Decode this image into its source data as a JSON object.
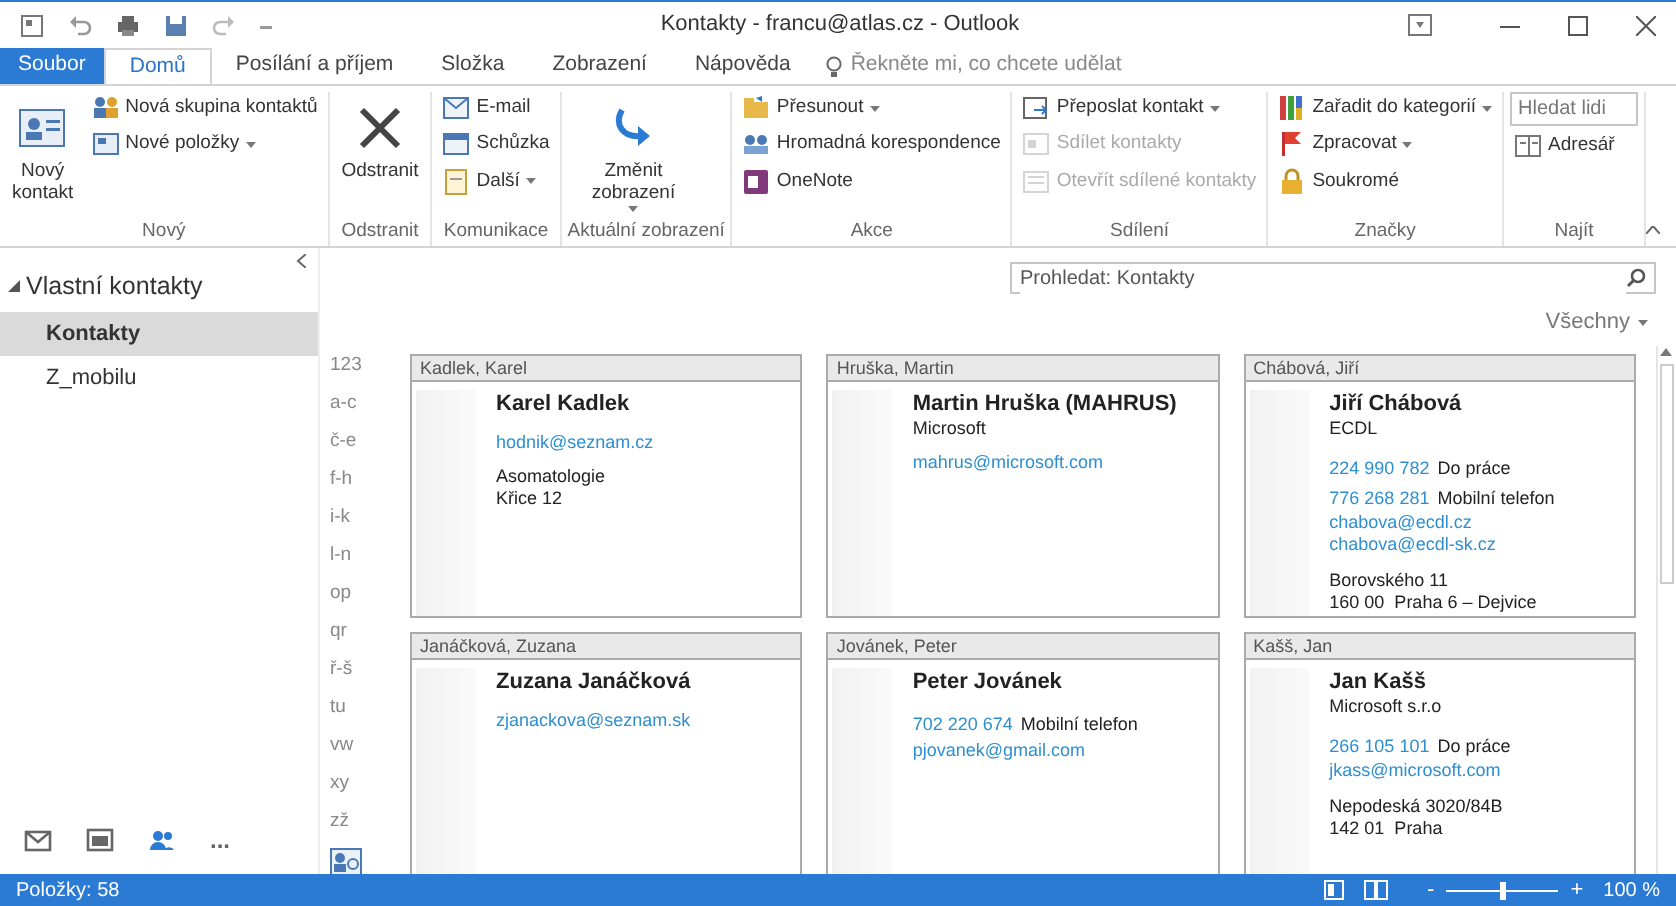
{
  "window": {
    "title": "Kontakty - francu@atlas.cz - Outlook"
  },
  "tabs": [
    {
      "label": "Soubor",
      "kind": "file",
      "selected": false
    },
    {
      "label": "Domů",
      "kind": "tab",
      "selected": true
    },
    {
      "label": "Posílání a příjem",
      "kind": "tab",
      "selected": false
    },
    {
      "label": "Složka",
      "kind": "tab",
      "selected": false
    },
    {
      "label": "Zobrazení",
      "kind": "tab",
      "selected": false
    },
    {
      "label": "Nápověda",
      "kind": "tab",
      "selected": false
    }
  ],
  "tell_me": {
    "placeholder": "Řekněte mi, co chcete udělat"
  },
  "ribbon": {
    "groups": [
      {
        "label": "Nový",
        "items": [
          {
            "kind": "large",
            "label": "Nový kontakt",
            "dropdown": false
          },
          {
            "kind": "stack",
            "items": [
              {
                "kind": "small",
                "label": "Nová skupina kontaktů",
                "dropdown": false,
                "disabled": false
              },
              {
                "kind": "small",
                "label": "Nové položky",
                "dropdown": true,
                "disabled": false
              }
            ]
          }
        ]
      },
      {
        "label": "Odstranit",
        "items": [
          {
            "kind": "large",
            "label": "Odstranit",
            "dropdown": false
          }
        ]
      },
      {
        "label": "Komunikace",
        "items": [
          {
            "kind": "stack",
            "items": [
              {
                "kind": "small",
                "label": "E-mail",
                "dropdown": false,
                "disabled": false
              },
              {
                "kind": "small",
                "label": "Schůzka",
                "dropdown": false,
                "disabled": false
              },
              {
                "kind": "small",
                "label": "Další",
                "dropdown": true,
                "disabled": false
              }
            ]
          }
        ]
      },
      {
        "label": "Aktuální zobrazení",
        "items": [
          {
            "kind": "large",
            "label": "Změnit zobrazení",
            "dropdown": true
          }
        ]
      },
      {
        "label": "Akce",
        "items": [
          {
            "kind": "stack",
            "items": [
              {
                "kind": "small",
                "label": "Přesunout",
                "dropdown": true,
                "disabled": false
              },
              {
                "kind": "small",
                "label": "Hromadná korespondence",
                "dropdown": false,
                "disabled": false
              },
              {
                "kind": "small",
                "label": "OneNote",
                "dropdown": false,
                "disabled": false
              }
            ]
          }
        ]
      },
      {
        "label": "Sdílení",
        "items": [
          {
            "kind": "stack",
            "items": [
              {
                "kind": "small",
                "label": "Přeposlat kontakt",
                "dropdown": true,
                "disabled": false
              },
              {
                "kind": "small",
                "label": "Sdílet kontakty",
                "dropdown": false,
                "disabled": true
              },
              {
                "kind": "small",
                "label": "Otevřít sdílené kontakty",
                "dropdown": false,
                "disabled": true
              }
            ]
          }
        ]
      },
      {
        "label": "Značky",
        "items": [
          {
            "kind": "stack",
            "items": [
              {
                "kind": "small",
                "label": "Zařadit do kategorií",
                "dropdown": true,
                "disabled": false
              },
              {
                "kind": "small",
                "label": "Zpracovat",
                "dropdown": true,
                "disabled": false
              },
              {
                "kind": "small",
                "label": "Soukromé",
                "dropdown": false,
                "disabled": false
              }
            ]
          }
        ]
      },
      {
        "label": "Najít",
        "items": [
          {
            "kind": "stack",
            "items": [
              {
                "kind": "field",
                "placeholder": "Hledat lidi"
              },
              {
                "kind": "small",
                "label": "Adresář",
                "dropdown": false,
                "disabled": false
              }
            ]
          }
        ]
      }
    ]
  },
  "folders": {
    "group": "Vlastní kontakty",
    "items": [
      {
        "label": "Kontakty",
        "selected": true
      },
      {
        "label": "Z_mobilu",
        "selected": false
      }
    ]
  },
  "nav_bar": [
    {
      "kind": "mail",
      "selected": false
    },
    {
      "kind": "calendar",
      "selected": false
    },
    {
      "kind": "people",
      "selected": true
    },
    {
      "kind": "more",
      "label": "...",
      "selected": false
    }
  ],
  "search": {
    "placeholder": "Prohledat: Kontakty"
  },
  "filter": {
    "label": "Všechny"
  },
  "index": [
    "123",
    "a-c",
    "č-e",
    "f-h",
    "i-k",
    "l-n",
    "op",
    "qr",
    "ř-š",
    "tu",
    "vw",
    "xy",
    "zž"
  ],
  "cards": [
    {
      "header": "Kadlek, Karel",
      "name": "Karel Kadlek",
      "contacts": [
        {
          "kind": "email",
          "value": "hodnik@seznam.cz"
        }
      ],
      "address": [
        "Asomatologie",
        "Křice 12"
      ]
    },
    {
      "header": "Hruška, Martin",
      "name": "Martin Hruška (MAHRUS)",
      "company": "Microsoft",
      "contacts": [
        {
          "kind": "email",
          "value": "mahrus@microsoft.com"
        }
      ]
    },
    {
      "header": "Chábová, Jiří",
      "name": "Jiří Chábová",
      "company": "ECDL",
      "contacts": [
        {
          "kind": "phone",
          "number": "224 990 782",
          "type": "Do práce"
        },
        {
          "kind": "phone",
          "number": "776 268 281",
          "type": "Mobilní telefon"
        },
        {
          "kind": "email",
          "value": "chabova@ecdl.cz"
        },
        {
          "kind": "email",
          "value": "chabova@ecdl-sk.cz"
        }
      ],
      "address": [
        "Borovského 11",
        "160 00  Praha 6 – Dejvice"
      ]
    },
    {
      "header": "Janáčková, Zuzana",
      "name": "Zuzana Janáčková",
      "contacts": [
        {
          "kind": "email",
          "value": "zjanackova@seznam.sk"
        }
      ]
    },
    {
      "header": "Jovánek, Peter",
      "name": "Peter Jovánek",
      "contacts": [
        {
          "kind": "phone",
          "number": "702 220 674",
          "type": "Mobilní telefon"
        },
        {
          "kind": "email",
          "value": "pjovanek@gmail.com"
        }
      ]
    },
    {
      "header": "Kašš, Jan",
      "name": "Jan Kašš",
      "company": "Microsoft s.r.o",
      "contacts": [
        {
          "kind": "phone",
          "number": "266 105 101",
          "type": "Do práce"
        },
        {
          "kind": "email",
          "value": "jkass@microsoft.com"
        }
      ],
      "address": [
        "Nepodeská 3020/84B",
        "142 01  Praha"
      ]
    }
  ],
  "status_bar": {
    "items": "Položky: 58",
    "zoom": {
      "minus": "-",
      "plus": "+",
      "level": 0.5,
      "reading": "100 %"
    }
  }
}
